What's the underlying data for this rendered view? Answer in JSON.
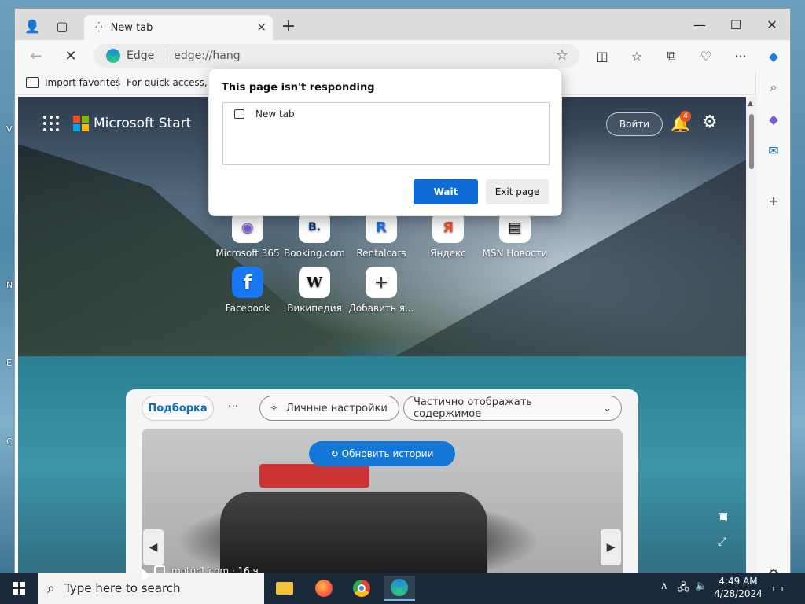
{
  "window": {
    "tab_title": "New tab",
    "tab_close": "×",
    "new_tab": "+"
  },
  "toolbar": {
    "back_icon": "←",
    "stop_icon": "✕",
    "site_label": "Edge",
    "url": "edge://hang",
    "favorite_icon": "☆"
  },
  "favbar": {
    "import_label": "Import favorites",
    "quick_access_label": "For quick access, place your favorites here."
  },
  "content": {
    "brand": "Microsoft Start",
    "login_label": "Войти",
    "notification_count": "4",
    "tiles": [
      {
        "label": "Microsoft 365",
        "icon": "m365-icon"
      },
      {
        "label": "Booking.com",
        "icon": "booking-icon",
        "glyph": "B."
      },
      {
        "label": "Rentalcars",
        "icon": "rentalcars-icon",
        "glyph": "R"
      },
      {
        "label": "Яндекс",
        "icon": "yandex-icon",
        "glyph": "Я"
      },
      {
        "label": "MSN Новости",
        "icon": "msn-news-icon",
        "glyph": "▤"
      },
      {
        "label": "Facebook",
        "icon": "facebook-icon",
        "glyph": "f"
      },
      {
        "label": "Википедия",
        "icon": "wikipedia-icon",
        "glyph": "W"
      },
      {
        "label": "Добавить я...",
        "icon": "add-icon",
        "glyph": "+"
      }
    ],
    "feed": {
      "tab_active": "Подборка",
      "more": "···",
      "personalize": "Личные настройки",
      "content_mode": "Частично отображать содержимое",
      "refresh": "Обновить истории",
      "source": "motor1.com · 16 ч"
    }
  },
  "dialog": {
    "title": "This page isn't responding",
    "item": "New tab",
    "wait": "Wait",
    "exit": "Exit page"
  },
  "taskbar": {
    "search_placeholder": "Type here to search",
    "time": "4:49 AM",
    "date": "4/28/2024"
  }
}
